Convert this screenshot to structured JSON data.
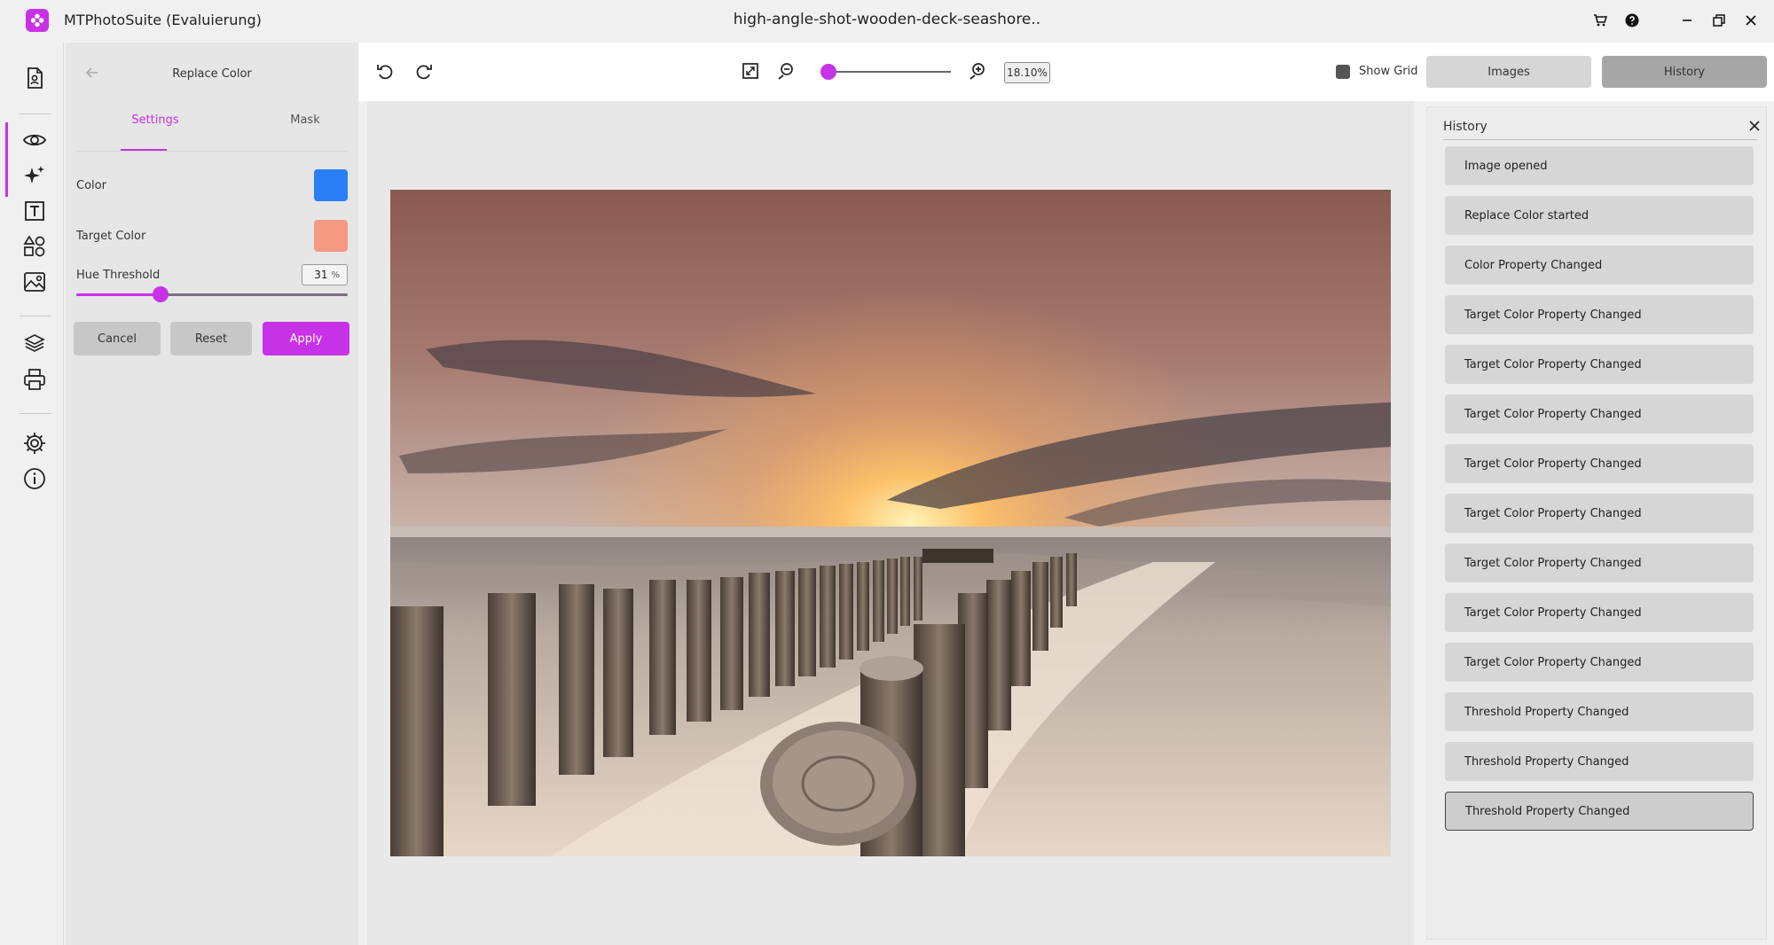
{
  "window": {
    "app_title": "MTPhotoSuite (Evaluierung)",
    "document_title": "high-angle-shot-wooden-deck-seashore..",
    "accent_color": "#c832e6"
  },
  "rail": {
    "items": [
      "document-icon",
      "eye-icon",
      "sparkles-icon",
      "text-icon",
      "shapes-icon",
      "image-icon",
      "layers-icon",
      "printer-icon",
      "gear-icon",
      "info-icon"
    ]
  },
  "tool_panel": {
    "title": "Replace Color",
    "tabs": [
      {
        "label": "Settings",
        "active": true
      },
      {
        "label": "Mask",
        "active": false
      }
    ],
    "color_label": "Color",
    "color_value": "#2b7ff5",
    "target_color_label": "Target Color",
    "target_color_value": "#f49a82",
    "hue_threshold_label": "Hue Threshold",
    "hue_threshold_value": "31",
    "hue_threshold_unit": "%",
    "buttons": {
      "cancel": "Cancel",
      "reset": "Reset",
      "apply": "Apply"
    }
  },
  "toolbar": {
    "zoom_percent": "18.10%",
    "zoom_level_fraction": 0.04,
    "show_grid_label": "Show Grid",
    "show_grid_checked": true,
    "tabs": {
      "images": "Images",
      "history": "History"
    }
  },
  "history_panel": {
    "title": "History",
    "items": [
      "Image opened",
      "Replace Color started",
      "Color Property Changed",
      "Target Color Property Changed",
      "Target Color Property Changed",
      "Target Color Property Changed",
      "Target Color Property Changed",
      "Target Color Property Changed",
      "Target Color Property Changed",
      "Target Color Property Changed",
      "Target Color Property Changed",
      "Threshold Property Changed",
      "Threshold Property Changed",
      "Threshold Property Changed"
    ],
    "selected_index": 13
  }
}
